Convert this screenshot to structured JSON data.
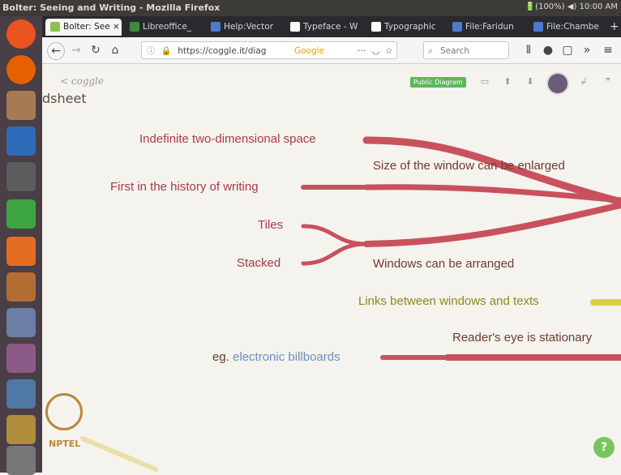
{
  "window": {
    "title": "Bolter: Seeing and Writing - Mozilla Firefox",
    "status": "🔋(100%)  ◀)  10:00 AM"
  },
  "browser": {
    "tabs": [
      {
        "label": "Bolter: See ×",
        "color": "#8bc34a"
      },
      {
        "label": "Libreoffice_",
        "color": "#3d8b40"
      },
      {
        "label": "Help:Vector",
        "color": "#4a7bd0"
      },
      {
        "label": "Typeface - W",
        "color": "#ffffff"
      },
      {
        "label": "Typographic",
        "color": "#ffffff"
      },
      {
        "label": "File:Faridun",
        "color": "#4a7bd0"
      },
      {
        "label": "File:Chambe",
        "color": "#4a7bd0"
      }
    ],
    "new_tab": "+",
    "url": "https://coggle.it/diag",
    "search_engine": "Google",
    "search_placeholder": "Search"
  },
  "coggle": {
    "back_label": "< coggle",
    "doc_title": "dsheet",
    "badge": "Public Diagram",
    "help_label": "?"
  },
  "mindmap": {
    "nodes": {
      "indefinite": "Indefinite two-dimensional space",
      "size": "Size of the window can be enlarged",
      "first": "First in the history of writing",
      "tiles": "Tiles",
      "stacked": "Stacked",
      "arranged": "Windows can be arranged",
      "links": "Links between windows and texts",
      "reader": "Reader's eye is stationary",
      "eg_prefix": "eg.",
      "eg_link": "electronic billboards"
    },
    "colors": {
      "red": "#c9515e",
      "olive": "#d8cf3e"
    }
  },
  "watermark": {
    "label": "NPTEL"
  }
}
